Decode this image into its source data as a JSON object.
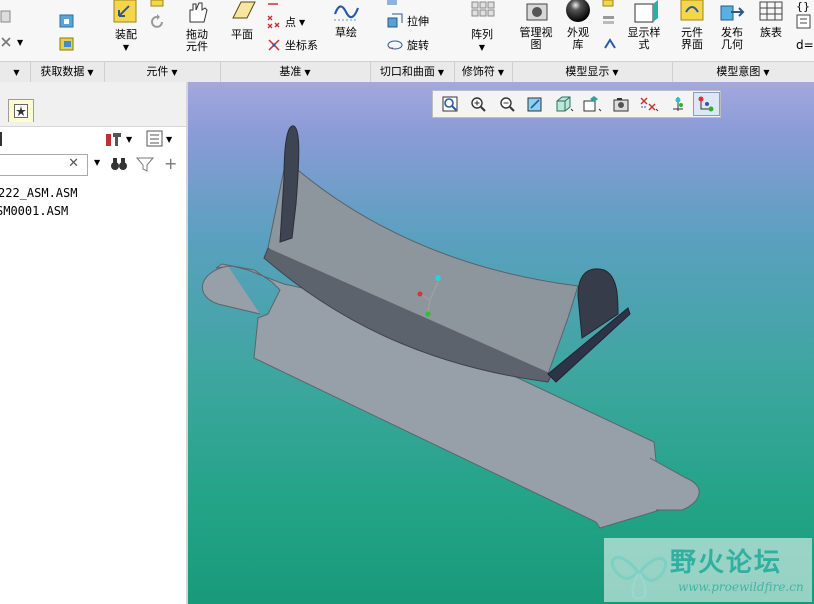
{
  "ribbon": {
    "assemble": "装配",
    "drag_component": "拖动\n元件",
    "plane": "平面",
    "point": "点",
    "csys": "坐标系",
    "sketch": "草绘",
    "extrude": "拉伸",
    "revolve": "旋转",
    "pattern": "阵列",
    "manage_views": "管理视\n图",
    "appearance": "外观\n库",
    "display_style": "显示样\n式",
    "component_interface": "元件\n界面",
    "publish_geometry": "发布\n几何",
    "family_table": "族表",
    "d_equals": "d="
  },
  "groups": {
    "get_data": "获取数据",
    "component": "元件",
    "datum": "基准",
    "cuts_surfaces": "切口和曲面",
    "modifiers": "修饰符",
    "model_display": "模型显示",
    "model_intent": "模型意图"
  },
  "tree": {
    "items": [
      "222_ASM.ASM",
      "SM0001.ASM"
    ],
    "search_value": ""
  },
  "watermark": {
    "title": "野火论坛",
    "url": "www.proewildfire.cn"
  },
  "colors": {
    "bg_top": "#a4a8de",
    "bg_bottom": "#179a7a",
    "part": "#8e969e",
    "part_dark": "#3c4250"
  }
}
